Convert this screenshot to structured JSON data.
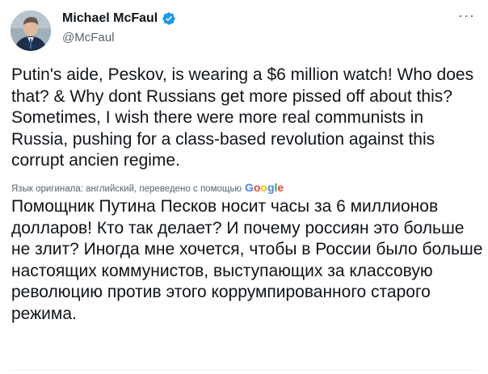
{
  "author": {
    "name": "Michael McFaul",
    "handle": "@McFaul",
    "verified_color": "#1d9bf0"
  },
  "menu_icon": "more-horizontal-icon",
  "tweet": {
    "text": "Putin's aide, Peskov, is wearing a $6 million watch! Who does that? & Why dont Russians get more pissed off about this? Sometimes, I wish there were more real communists in Russia, pushing for a class-based revolution against this corrupt ancien regime.",
    "translation_note": "Язык оригинала: английский, переведено с помощью",
    "translation_provider": "Google",
    "translated_text": "Помощник Путина Песков носит часы за 6 миллионов долларов! Кто так делает? И почему россиян это больше не злит? Иногда мне хочется, чтобы в России было больше настоящих коммунистов, выступающих за классовую революцию против этого коррумпированного старого режима."
  }
}
